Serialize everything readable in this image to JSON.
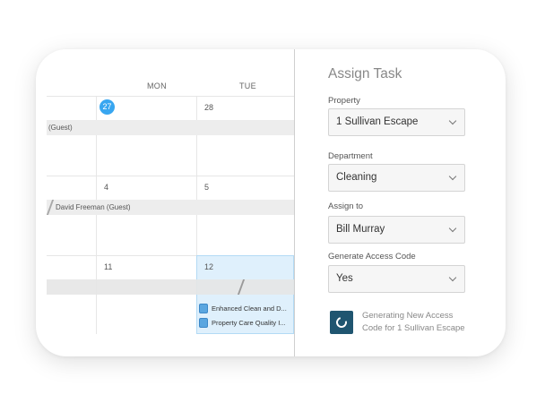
{
  "calendar": {
    "day_headers": [
      "MON",
      "TUE"
    ],
    "week1": {
      "mon_date": "27",
      "tue_date": "28",
      "band_label": "(Guest)"
    },
    "week2": {
      "mon_date": "4",
      "tue_date": "5",
      "band_label": "David Freeman (Guest)"
    },
    "week3": {
      "mon_date": "11",
      "tue_date": "12"
    },
    "events": [
      {
        "label": "Enhanced Clean and D...",
        "icon": "task-icon"
      },
      {
        "label": "Property Care Quality I...",
        "icon": "task-icon"
      }
    ],
    "today_color": "#38a6f0",
    "selected_cell_color": "#dff0fc"
  },
  "panel": {
    "title": "Assign Task",
    "fields": [
      {
        "label": "Property",
        "value": "1 Sullivan Escape"
      },
      {
        "label": "Department",
        "value": "Cleaning"
      },
      {
        "label": "Assign to",
        "value": "Bill Murray"
      },
      {
        "label": "Generate Access Code",
        "value": "Yes"
      }
    ],
    "status": {
      "icon": "sync-icon",
      "line1": "Generating New Access",
      "line2": "Code for 1 Sullivan Escape",
      "icon_color": "#1f5570"
    }
  }
}
